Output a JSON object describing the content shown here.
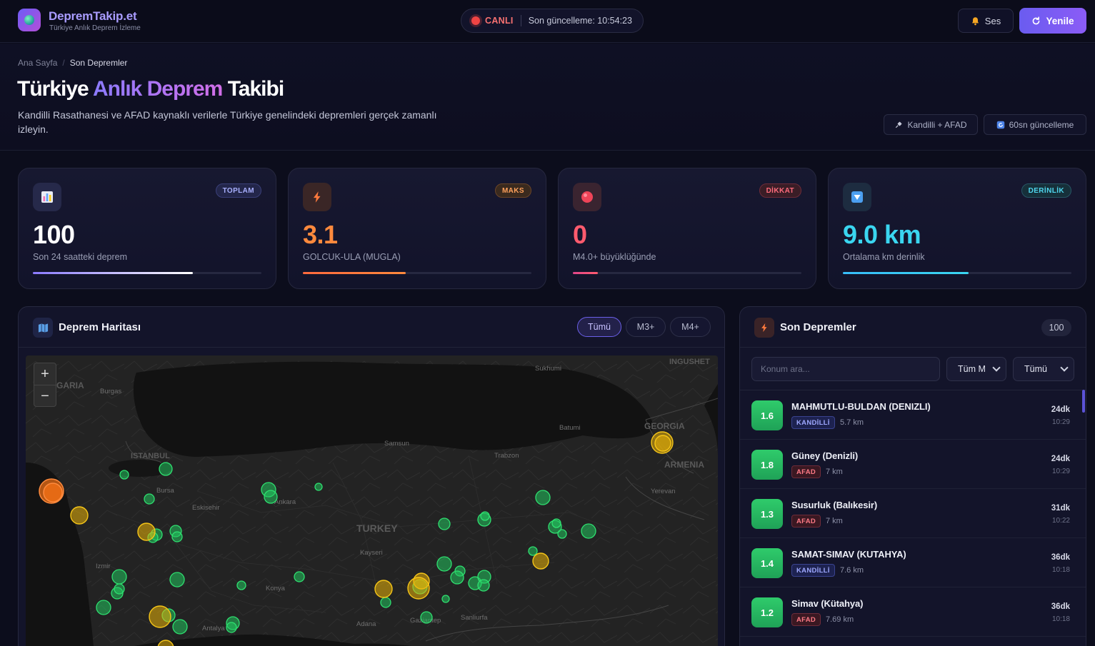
{
  "header": {
    "brand": "DepremTakip.et",
    "tagline": "Türkiye Anlık Deprem İzleme",
    "live_label": "CANLI",
    "last_update": "Son güncelleme: 10:54:23",
    "sound_label": "Ses",
    "refresh_label": "Yenile"
  },
  "hero": {
    "breadcrumb_home": "Ana Sayfa",
    "breadcrumb_current": "Son Depremler",
    "title_pre": "Türkiye",
    "title_highlight": "Anlık Deprem",
    "title_post": "Takibi",
    "description": "Kandilli Rasathanesi ve AFAD kaynaklı verilerle Türkiye genelindeki depremleri gerçek zamanlı izleyin.",
    "chip_sources": "Kandilli + AFAD",
    "chip_refresh": "60sn güncelleme"
  },
  "stats": [
    {
      "tag": "TOPLAM",
      "value": "100",
      "label": "Son 24 saatteki deprem",
      "progress": 0.7,
      "color": "#ffffff",
      "accent": "#8b7bff"
    },
    {
      "tag": "MAKS",
      "value": "3.1",
      "label": "GOLCUK-ULA (MUGLA)",
      "progress": 0.45,
      "color": "#ff8a3d",
      "accent": "#ff6a3d"
    },
    {
      "tag": "DİKKAT",
      "value": "0",
      "label": "M4.0+ büyüklüğünde",
      "progress": 0.11,
      "color": "#ff5b6e",
      "accent": "#e0468a"
    },
    {
      "tag": "DERİNLİK",
      "value": "9.0 km",
      "label": "Ortalama km derinlik",
      "progress": 0.55,
      "color": "#3ad6f0",
      "accent": "#38bdf8"
    }
  ],
  "map": {
    "title": "Deprem Haritası",
    "filters": [
      "Tümü",
      "M3+",
      "M4+"
    ],
    "active_filter": "Tümü",
    "zoom_in": "+",
    "zoom_out": "−",
    "labels": [
      "Sukhumi",
      "INGUSHET",
      "GARIA",
      "Burgas",
      "Batumi",
      "GEORGIA",
      "Samsun",
      "ISTANBUL",
      "Trabzon",
      "ARMENIA",
      "Bursa",
      "Ankara",
      "Yerevan",
      "Eskisehir",
      "TURKEY",
      "Kayseri",
      "Izmir",
      "Konya",
      "Antalya",
      "Adana",
      "Gaziantep",
      "Sanliurfa"
    ]
  },
  "quakes": {
    "title": "Son Depremler",
    "count": "100",
    "search_placeholder": "Konum ara...",
    "mag_filter": "Tüm M",
    "source_filter": "Tümü",
    "items": [
      {
        "mag": "1.6",
        "location": "MAHMUTLU-BULDAN (DENIZLI)",
        "source": "KANDİLLİ",
        "depth": "5.7 km",
        "ago": "24dk",
        "time": "10:29"
      },
      {
        "mag": "1.8",
        "location": "Güney (Denizli)",
        "source": "AFAD",
        "depth": "7 km",
        "ago": "24dk",
        "time": "10:29"
      },
      {
        "mag": "1.3",
        "location": "Susurluk (Balıkesir)",
        "source": "AFAD",
        "depth": "7 km",
        "ago": "31dk",
        "time": "10:22"
      },
      {
        "mag": "1.4",
        "location": "SAMAT-SIMAV (KUTAHYA)",
        "source": "KANDİLLİ",
        "depth": "7.6 km",
        "ago": "36dk",
        "time": "10:18"
      },
      {
        "mag": "1.2",
        "location": "Simav (Kütahya)",
        "source": "AFAD",
        "depth": "7.69 km",
        "ago": "36dk",
        "time": "10:18"
      }
    ]
  },
  "colors": {
    "accent": "#7c5cf6",
    "marker_small": "#22c55e",
    "marker_medium": "#eab308",
    "marker_large": "#f97316"
  }
}
